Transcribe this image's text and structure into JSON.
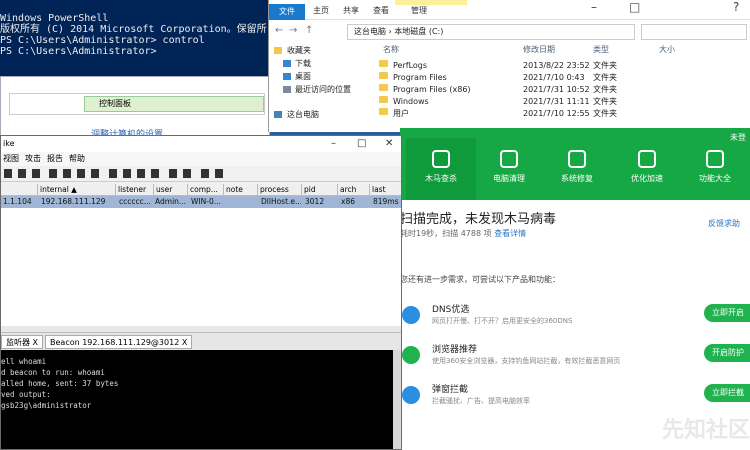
{
  "powershell": {
    "lines": [
      "Windows PowerShell",
      "版权所有 (C) 2014 Microsoft Corporation。保留所",
      "",
      "PS C:\\Users\\Administrator> control",
      "PS C:\\Users\\Administrator>"
    ]
  },
  "control_panel": {
    "address": "控制面板",
    "link": "调整计算机的设置"
  },
  "explorer": {
    "ribbon_tabs": [
      "文件",
      "主页",
      "共享",
      "查看",
      "管理"
    ],
    "address_path": "这台电脑 › 本地磁盘 (C:)",
    "tree": [
      "收藏夹",
      "下载",
      "桌面",
      "最近访问的位置",
      "这台电脑"
    ],
    "columns": [
      "名称",
      "修改日期",
      "类型",
      "大小"
    ],
    "rows": [
      {
        "name": "PerfLogs",
        "date": "2013/8/22 23:52",
        "type": "文件夹"
      },
      {
        "name": "Program Files",
        "date": "2021/7/10 0:43",
        "type": "文件夹"
      },
      {
        "name": "Program Files (x86)",
        "date": "2021/7/31 10:52",
        "type": "文件夹"
      },
      {
        "name": "Windows",
        "date": "2021/7/31 11:11",
        "type": "文件夹"
      },
      {
        "name": "用户",
        "date": "2021/7/10 12:55",
        "type": "文件夹"
      }
    ]
  },
  "security": {
    "corner": "未登",
    "tabs": [
      "木马查杀",
      "电脑清理",
      "系统修复",
      "优化加速",
      "功能大全"
    ],
    "scan_msg": "扫描完成，未发现木马病毒",
    "scan_sub": "耗时19秒，扫描 4788 项",
    "details_link": "查看详情",
    "feedback": "反馈求助",
    "intro": "您还有进一步需求，可尝试以下产品和功能：",
    "items": [
      {
        "title": "DNS优选",
        "desc": "网页打开慢、打不开？启用更安全的360DNS",
        "button": "立即开启"
      },
      {
        "title": "浏览器推荐",
        "desc": "使用360安全浏览器，支持钓鱼网站拦截，有效拦截恶意网页",
        "button": "开启防护"
      },
      {
        "title": "弹窗拦截",
        "desc": "拦截骚扰、广告、提高电脑效率",
        "button": "立即拦截"
      }
    ],
    "watermark": "先知社区"
  },
  "cobalt": {
    "title": "ike",
    "menu": [
      "视图",
      "攻击",
      "报告",
      "帮助"
    ],
    "columns": [
      "internal ▲",
      "listener",
      "user",
      "comp...",
      "note",
      "process",
      "pid",
      "arch",
      "last"
    ],
    "row": {
      "external": "1.1.104",
      "internal": "192.168.111.129",
      "listener": "cccccc...",
      "user": "Admin...",
      "computer": "WIN-0...",
      "note": "",
      "process": "DllHost.e...",
      "pid": "3012",
      "arch": "x86",
      "last": "819ms"
    },
    "tabs": [
      "监听器 X",
      "Beacon 192.168.111.129@3012  X"
    ],
    "console": [
      "",
      "ell whoami",
      "d beacon to run: whoami",
      "alled home, sent: 37 bytes",
      "ved output:",
      "gsb23g\\administrator"
    ]
  }
}
